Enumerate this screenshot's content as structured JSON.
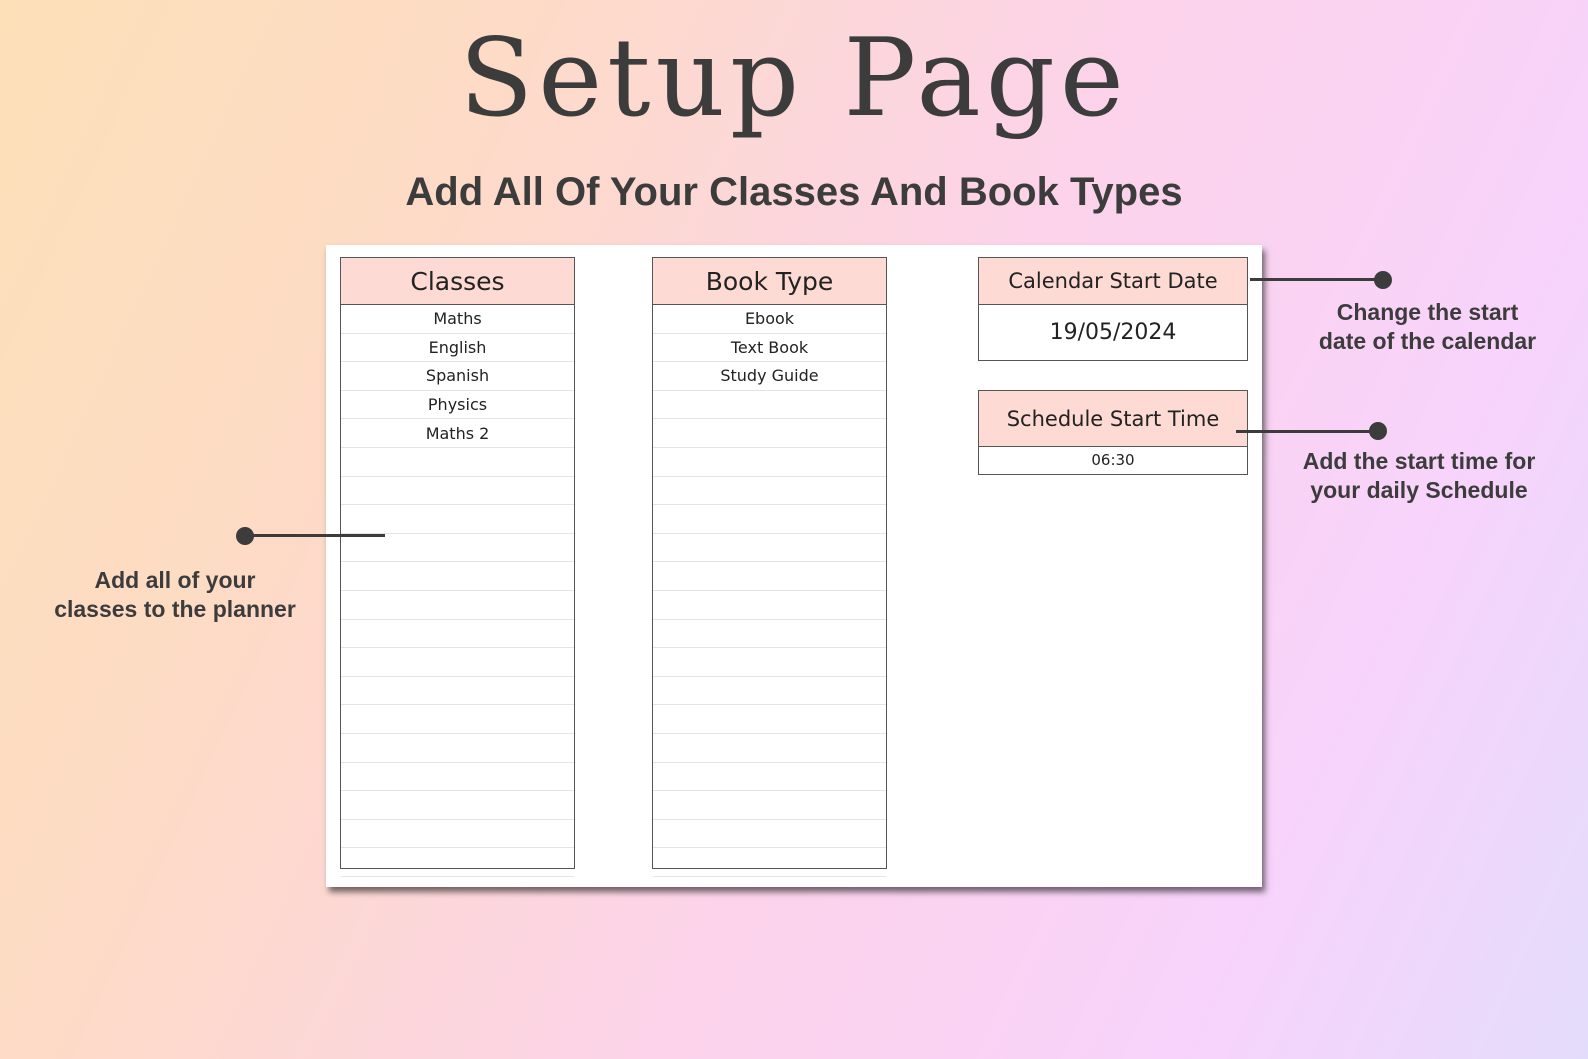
{
  "page": {
    "title": "Setup Page",
    "subtitle": "Add All Of Your Classes And Book Types"
  },
  "classes": {
    "header": "Classes",
    "items": [
      "Maths",
      "English",
      "Spanish",
      "Physics",
      "Maths 2",
      "",
      "",
      "",
      "",
      "",
      "",
      "",
      "",
      "",
      "",
      "",
      "",
      "",
      "",
      "",
      ""
    ]
  },
  "book_types": {
    "header": "Book Type",
    "items": [
      "Ebook",
      "Text Book",
      "Study Guide",
      "",
      "",
      "",
      "",
      "",
      "",
      "",
      "",
      "",
      "",
      "",
      "",
      "",
      "",
      "",
      "",
      "",
      ""
    ]
  },
  "calendar_start": {
    "label": "Calendar Start Date",
    "value": "19/05/2024"
  },
  "schedule_start": {
    "label": "Schedule Start Time",
    "value": "06:30"
  },
  "annotations": {
    "classes_note_line1": "Add all of your",
    "classes_note_line2": "classes to the planner",
    "calendar_note_line1": "Change the start",
    "calendar_note_line2": "date of the calendar",
    "schedule_note_line1": "Add the start time for",
    "schedule_note_line2": "your daily Schedule"
  },
  "colors": {
    "header_fill": "#fddad4",
    "text_dark": "#3c3c3c"
  }
}
